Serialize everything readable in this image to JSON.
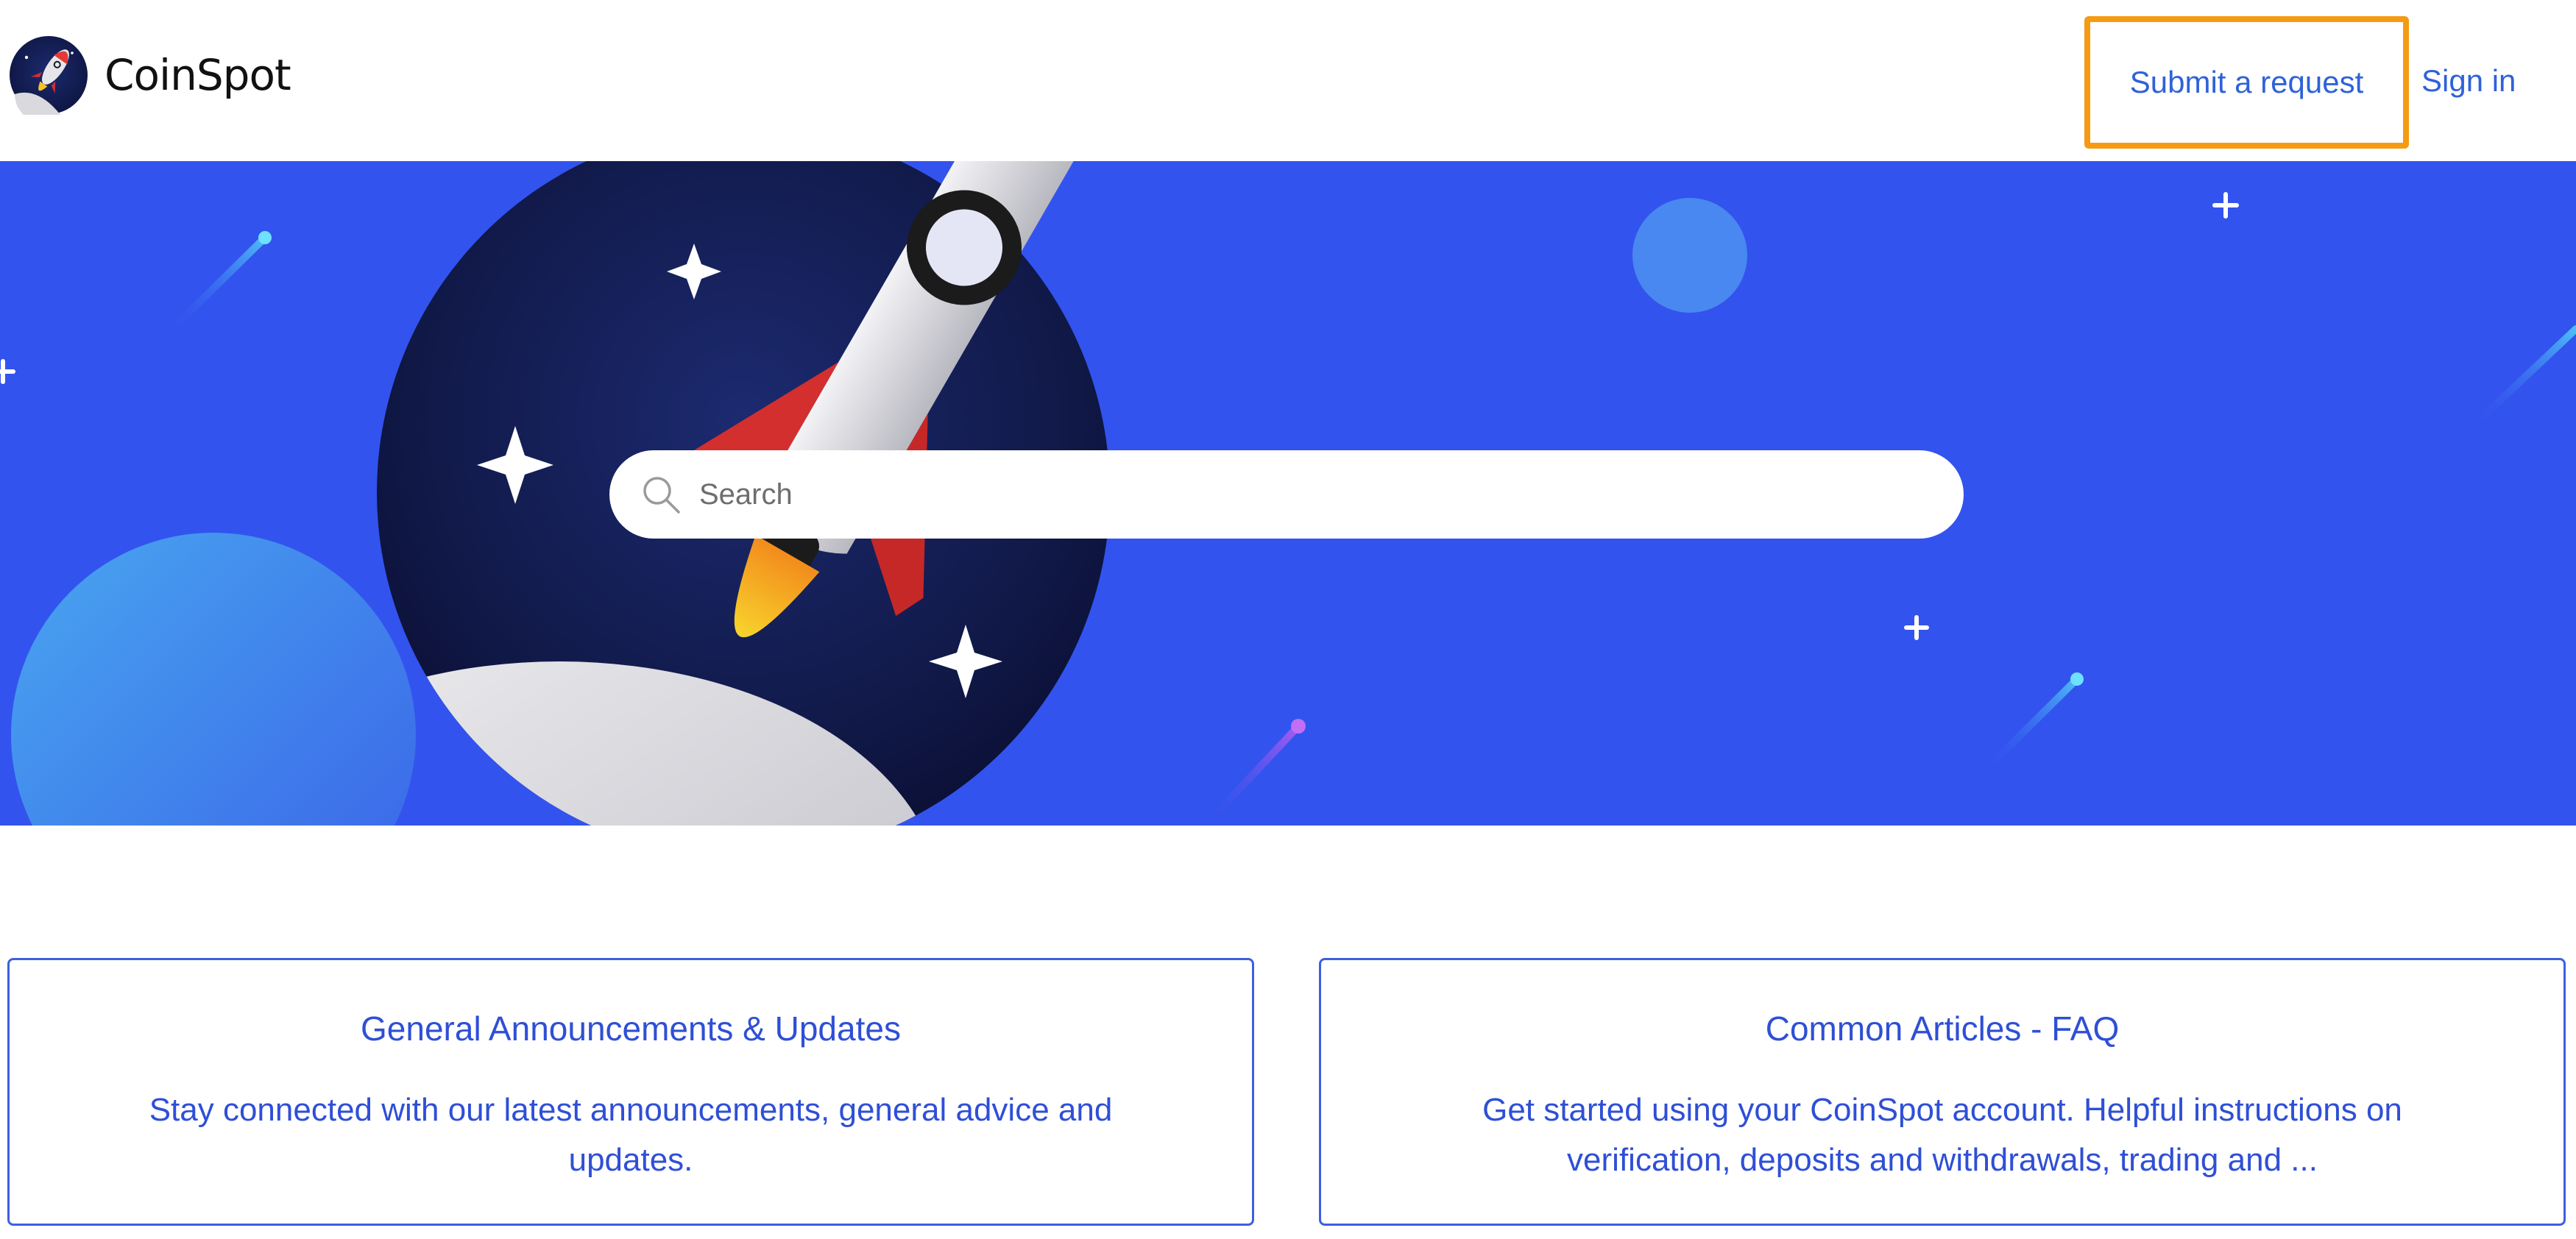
{
  "header": {
    "brand_name": "CoinSpot",
    "nav": {
      "submit_request": "Submit a request",
      "sign_in": "Sign in"
    }
  },
  "hero": {
    "search": {
      "placeholder": "Search",
      "value": ""
    }
  },
  "categories": [
    {
      "title": "General Announcements & Updates",
      "description": "Stay connected with our latest announcements, general advice and updates."
    },
    {
      "title": "Common Articles - FAQ",
      "description": "Get started using your CoinSpot account. Helpful instructions on verification, deposits and withdrawals, trading and ..."
    }
  ],
  "colors": {
    "hero_background": "#3353ee",
    "link": "#2f62d8",
    "highlight_border": "#f59a12",
    "card_text": "#2f4fd6"
  },
  "icons": {
    "logo": "coinspot-rocket-logo-icon",
    "search": "search-icon"
  }
}
